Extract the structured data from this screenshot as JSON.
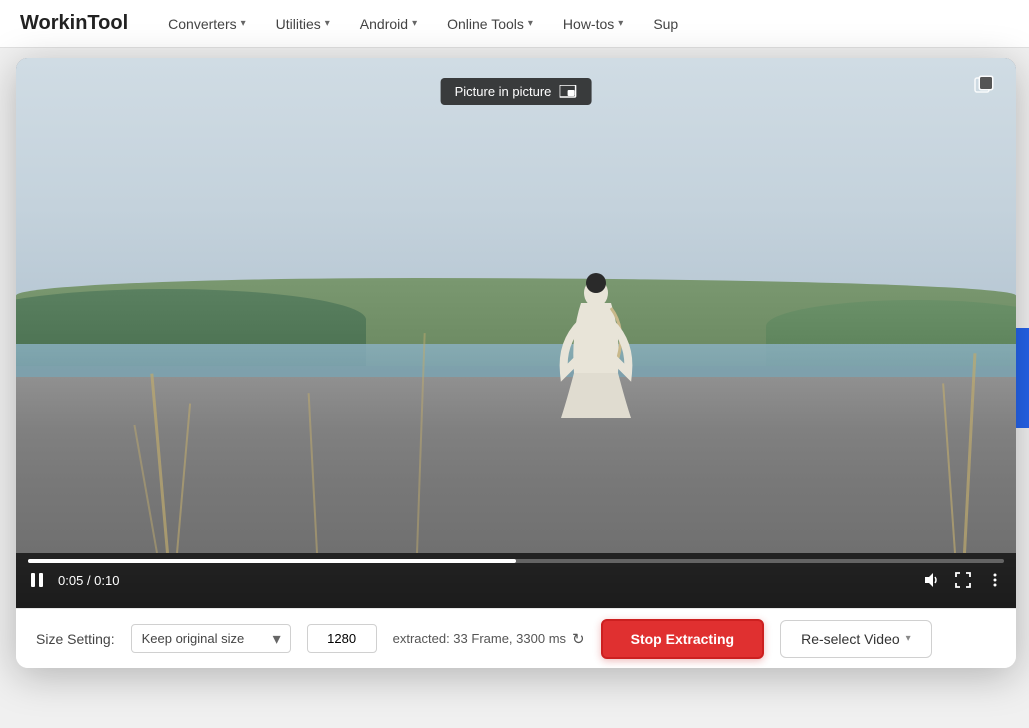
{
  "header": {
    "logo": "WorkinTool",
    "nav": [
      {
        "label": "Converters",
        "has_dropdown": true
      },
      {
        "label": "Utilities",
        "has_dropdown": true
      },
      {
        "label": "Android",
        "has_dropdown": true
      },
      {
        "label": "Online Tools",
        "has_dropdown": true
      },
      {
        "label": "How-tos",
        "has_dropdown": true
      },
      {
        "label": "Sup",
        "has_dropdown": false
      }
    ]
  },
  "video": {
    "pip_tooltip": "Picture in picture",
    "time_current": "0:05",
    "time_total": "0:10",
    "progress_percent": 50
  },
  "bottom_bar": {
    "size_setting_label": "Size Setting:",
    "size_option": "Keep original size",
    "width_value": "1280",
    "extracted_info": "extracted: 33 Frame, 3300 ms",
    "stop_btn_label": "Stop Extracting",
    "reselect_btn_label": "Re-select Video"
  }
}
